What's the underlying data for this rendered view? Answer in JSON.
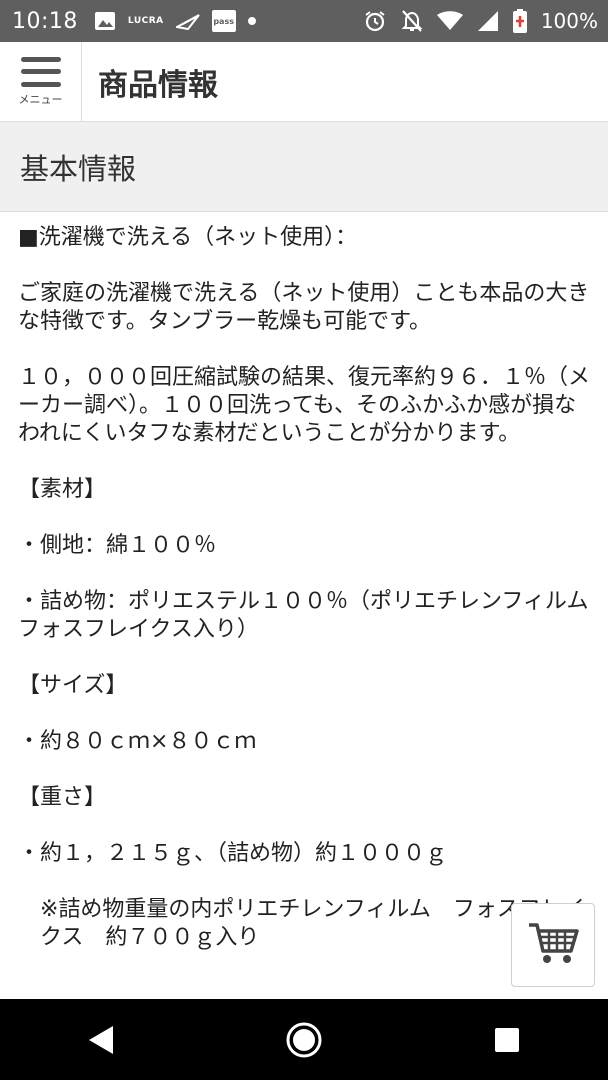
{
  "status_bar": {
    "time": "10:18",
    "icons_left": [
      "image-icon",
      "lucra-icon",
      "bird-icon",
      "pass-icon",
      "dot-icon"
    ],
    "lucra_text": "LUCRA",
    "pass_text": "pass",
    "icons_right": [
      "alarm-icon",
      "notifications-off-icon",
      "wifi-icon",
      "signal-icon",
      "battery-icon"
    ],
    "battery": "100%"
  },
  "header": {
    "menu_label": "メニュー",
    "title": "商品情報"
  },
  "section": {
    "title": "基本情報"
  },
  "content": {
    "paragraphs": [
      "■洗濯機で洗える（ネット使用）：",
      "ご家庭の洗濯機で洗える（ネット使用）ことも本品の大きな特徴です。タンブラー乾燥も可能です。",
      "１０，０００回圧縮試験の結果、復元率約９６．１％（メーカー調べ）。１００回洗っても、そのふかふか感が損なわれにくいタフな素材だということが分かります。",
      "【素材】",
      "・側地：綿１００％",
      "・詰め物：ポリエステル１００％（ポリエチレンフィルム　フォスフレイクス入り）",
      "【サイズ】",
      "・約８０ｃｍ×８０ｃｍ",
      "【重さ】",
      "・約１，２１５ｇ、（詰め物）約１０００ｇ",
      "※詰め物重量の内ポリエチレンフィルム　フォスフレイクス　約７００ｇ入り"
    ]
  },
  "colors": {
    "status_bar_bg": "#5f5f5f",
    "section_bg": "#f0f0f0",
    "nav_bar_bg": "#000000"
  },
  "nav": {
    "items": [
      "back-icon",
      "home-icon",
      "recents-icon"
    ]
  }
}
